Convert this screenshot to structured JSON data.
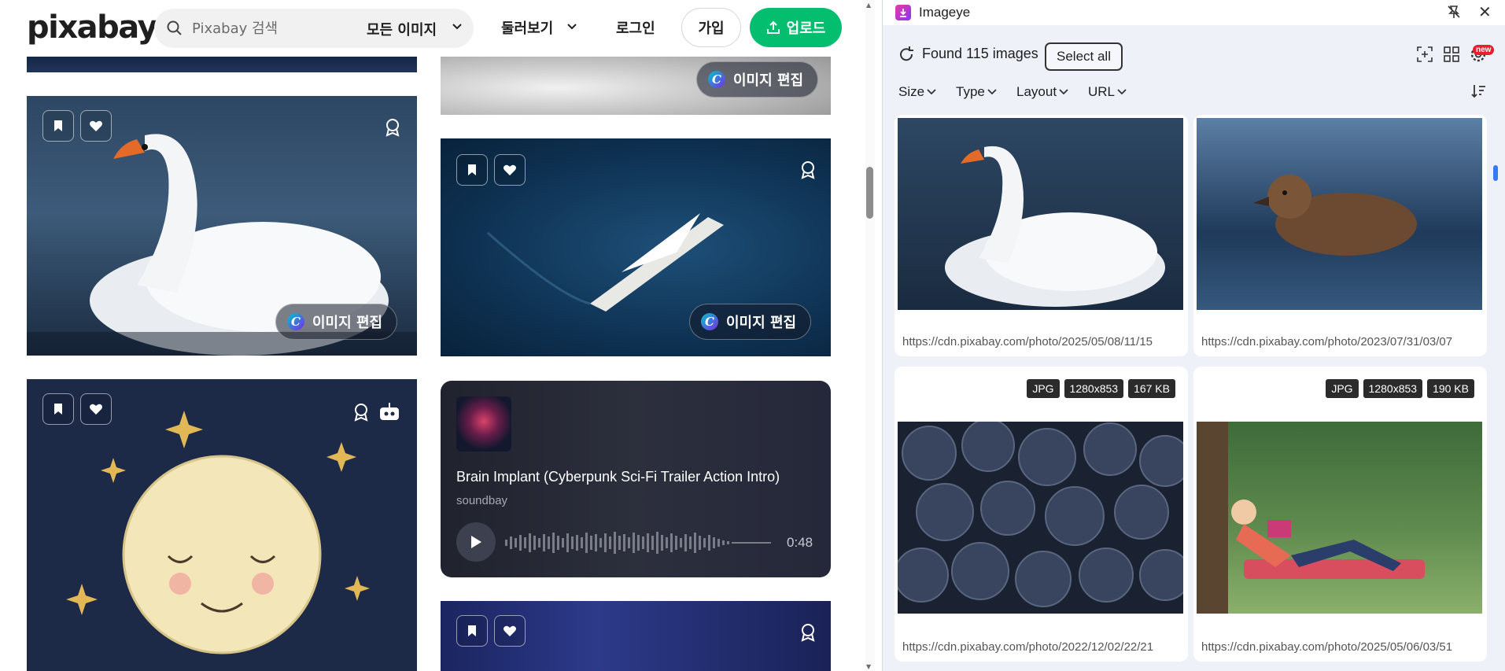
{
  "header": {
    "logo": "pixabay",
    "search_placeholder": "Pixabay 검색",
    "filter_label": "모든 이미지",
    "explore_label": "둘러보기",
    "login_label": "로그인",
    "join_label": "가입",
    "upload_label": "업로드"
  },
  "tiles": {
    "edit_label": "이미지 편집"
  },
  "audio": {
    "title": "Brain Implant (Cyberpunk Sci-Fi Trailer Action Intro)",
    "artist": "soundbay",
    "duration": "0:48"
  },
  "panel": {
    "app_name": "Imageye",
    "found_text": "Found 115 images",
    "select_all_label": "Select all",
    "new_badge": "new",
    "filters": [
      {
        "label": "Size"
      },
      {
        "label": "Type"
      },
      {
        "label": "Layout"
      },
      {
        "label": "URL"
      }
    ],
    "images": [
      {
        "url": "https://cdn.pixabay.com/photo/2025/05/08/11/15",
        "subject": "swan"
      },
      {
        "url": "https://cdn.pixabay.com/photo/2023/07/31/03/07",
        "subject": "duckling"
      },
      {
        "url": "https://cdn.pixabay.com/photo/2022/12/02/22/21",
        "subject": "blueberries",
        "format": "JPG",
        "dimensions": "1280x853",
        "size": "167 KB"
      },
      {
        "url": "https://cdn.pixabay.com/photo/2025/05/06/03/51",
        "subject": "reading-girl",
        "format": "JPG",
        "dimensions": "1280x853",
        "size": "190 KB"
      }
    ]
  },
  "colors": {
    "brand_green": "#02be6e",
    "panel_bg": "#eef1f8",
    "new_badge": "#e4202e"
  }
}
